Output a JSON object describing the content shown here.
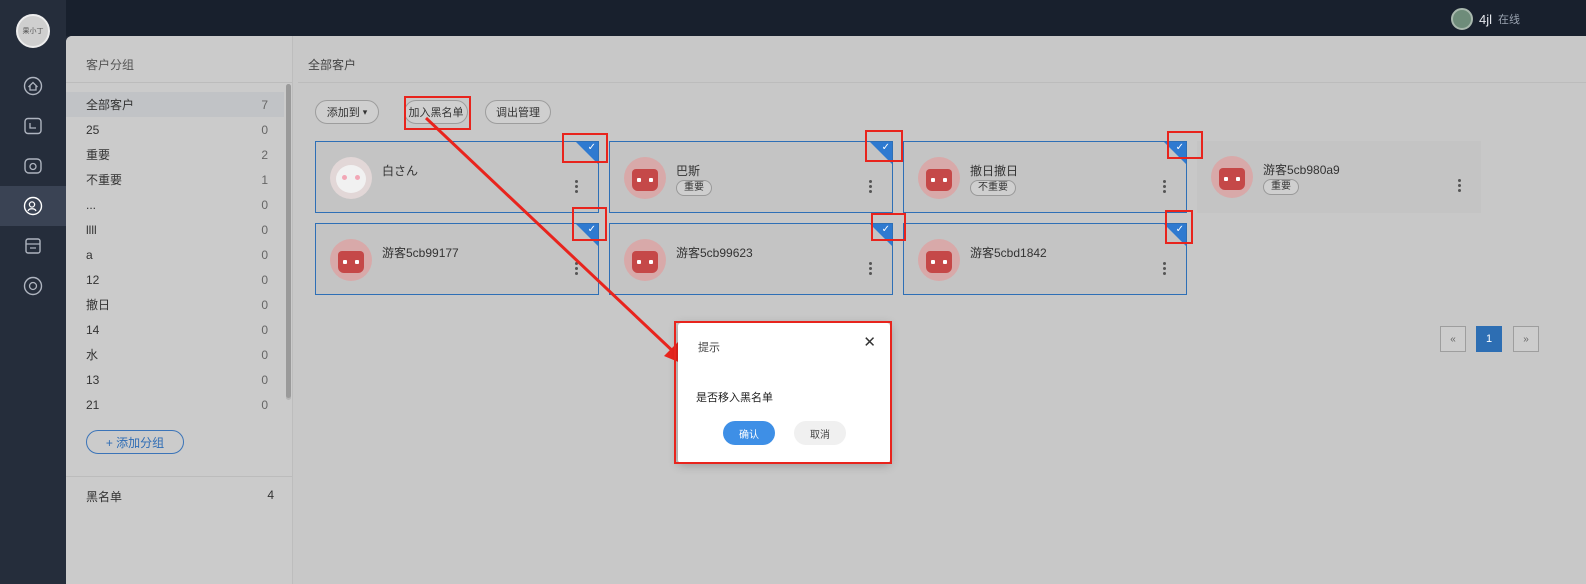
{
  "header": {
    "user_name": "4jl",
    "user_status": "在线"
  },
  "logo_text": "果小丁",
  "rail": {
    "items": [
      {
        "icon": "home-icon"
      },
      {
        "icon": "chat-icon"
      },
      {
        "icon": "stats-icon"
      },
      {
        "icon": "customers-icon",
        "active": true
      },
      {
        "icon": "store-icon"
      },
      {
        "icon": "settings-icon"
      }
    ]
  },
  "sidebar": {
    "title": "客户分组",
    "groups": [
      {
        "name": "全部客户",
        "count": "7",
        "active": true
      },
      {
        "name": "25",
        "count": "0"
      },
      {
        "name": "重要",
        "count": "2"
      },
      {
        "name": "不重要",
        "count": "1"
      },
      {
        "name": "...",
        "count": "0"
      },
      {
        "name": "llll",
        "count": "0"
      },
      {
        "name": "a",
        "count": "0"
      },
      {
        "name": "12",
        "count": "0"
      },
      {
        "name": "撤日",
        "count": "0"
      },
      {
        "name": "14",
        "count": "0"
      },
      {
        "name": "水",
        "count": "0"
      },
      {
        "name": "13",
        "count": "0"
      },
      {
        "name": "21",
        "count": "0"
      }
    ],
    "add_group_label": "+ 添加分组",
    "blacklist_label": "黑名单",
    "blacklist_count": "4"
  },
  "main": {
    "title": "全部客户",
    "toolbar": {
      "add_to_label": "添加到",
      "add_to_caret": "▾",
      "blacklist_label": "加入黑名单",
      "remove_label": "调出管理"
    },
    "cards": [
      {
        "name": "白さん",
        "tag": "",
        "avatar": "cat",
        "selected": true
      },
      {
        "name": "巴斯",
        "tag": "重要",
        "avatar": "face",
        "selected": true
      },
      {
        "name": "撤日撤日",
        "tag": "不重要",
        "avatar": "face",
        "selected": true
      },
      {
        "name": "游客5cb980a9",
        "tag": "重要",
        "avatar": "face",
        "selected": false
      },
      {
        "name": "游客5cb99177",
        "tag": "",
        "avatar": "face",
        "selected": true
      },
      {
        "name": "游客5cb99623",
        "tag": "",
        "avatar": "face",
        "selected": true
      },
      {
        "name": "游客5cbd1842",
        "tag": "",
        "avatar": "face",
        "selected": true
      }
    ],
    "check_glyph": "✓",
    "pagination": {
      "prev": "«",
      "current": "1",
      "next": "»"
    }
  },
  "dialog": {
    "title": "提示",
    "close_glyph": "✕",
    "message": "是否移入黑名单",
    "confirm_label": "确认",
    "cancel_label": "取消"
  },
  "colors": {
    "accent": "#2f7ad0",
    "annotation": "#e8241d",
    "confirm": "#3e8fe6"
  }
}
